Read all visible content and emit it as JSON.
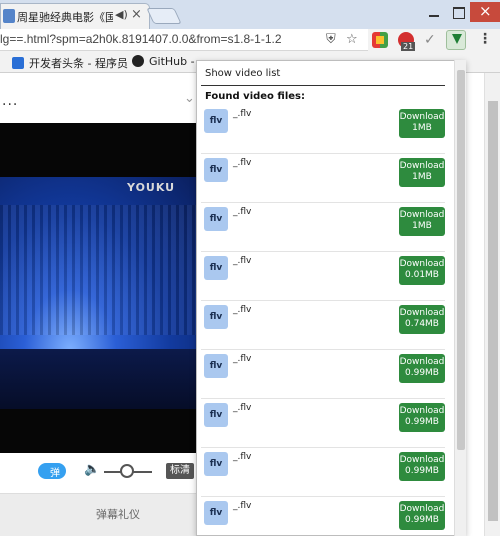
{
  "browser": {
    "tab": {
      "title": "周星驰经典电影《国",
      "audio_icon": "speaker-icon",
      "close_icon": "close-icon"
    },
    "window_controls": [
      "minimize",
      "maximize",
      "close"
    ],
    "url": "lg==.html?spm=a2h0k.8191407.0.0&from=s1.8-1-1.2",
    "extension_badge": "21",
    "bookmarks": [
      {
        "label": "开发者头条 - 程序员",
        "icon": "bookmark-icon"
      },
      {
        "label": "GitHub -",
        "icon": "github-icon"
      }
    ]
  },
  "page": {
    "ellipsis": "...",
    "video_watermark": "YOUKU",
    "danmu_toggle_label": "弹",
    "quality_label": "标清",
    "danmu_etiquette": "弹幕礼仪"
  },
  "popup": {
    "show_video_list": "Show video list",
    "found_label": "Found video files:",
    "files": [
      {
        "type": "flv",
        "name": "_.flv",
        "button_text": "Download",
        "size": "1MB"
      },
      {
        "type": "flv",
        "name": "_.flv",
        "button_text": "Download",
        "size": "1MB"
      },
      {
        "type": "flv",
        "name": "_.flv",
        "button_text": "Download",
        "size": "1MB"
      },
      {
        "type": "flv",
        "name": "_.flv",
        "button_text": "Download",
        "size": "0.01MB"
      },
      {
        "type": "flv",
        "name": "_.flv",
        "button_text": "Download",
        "size": "0.74MB"
      },
      {
        "type": "flv",
        "name": "_.flv",
        "button_text": "Download",
        "size": "0.99MB"
      },
      {
        "type": "flv",
        "name": "_.flv",
        "button_text": "Download",
        "size": "0.99MB"
      },
      {
        "type": "flv",
        "name": "_.flv",
        "button_text": "Download",
        "size": "0.99MB"
      },
      {
        "type": "flv",
        "name": "_.flv",
        "button_text": "Download",
        "size": "0.99MB"
      }
    ]
  },
  "colors": {
    "download_button": "#2e8b3e",
    "flv_icon": "#aac8ef",
    "toggle": "#35a0f0"
  }
}
